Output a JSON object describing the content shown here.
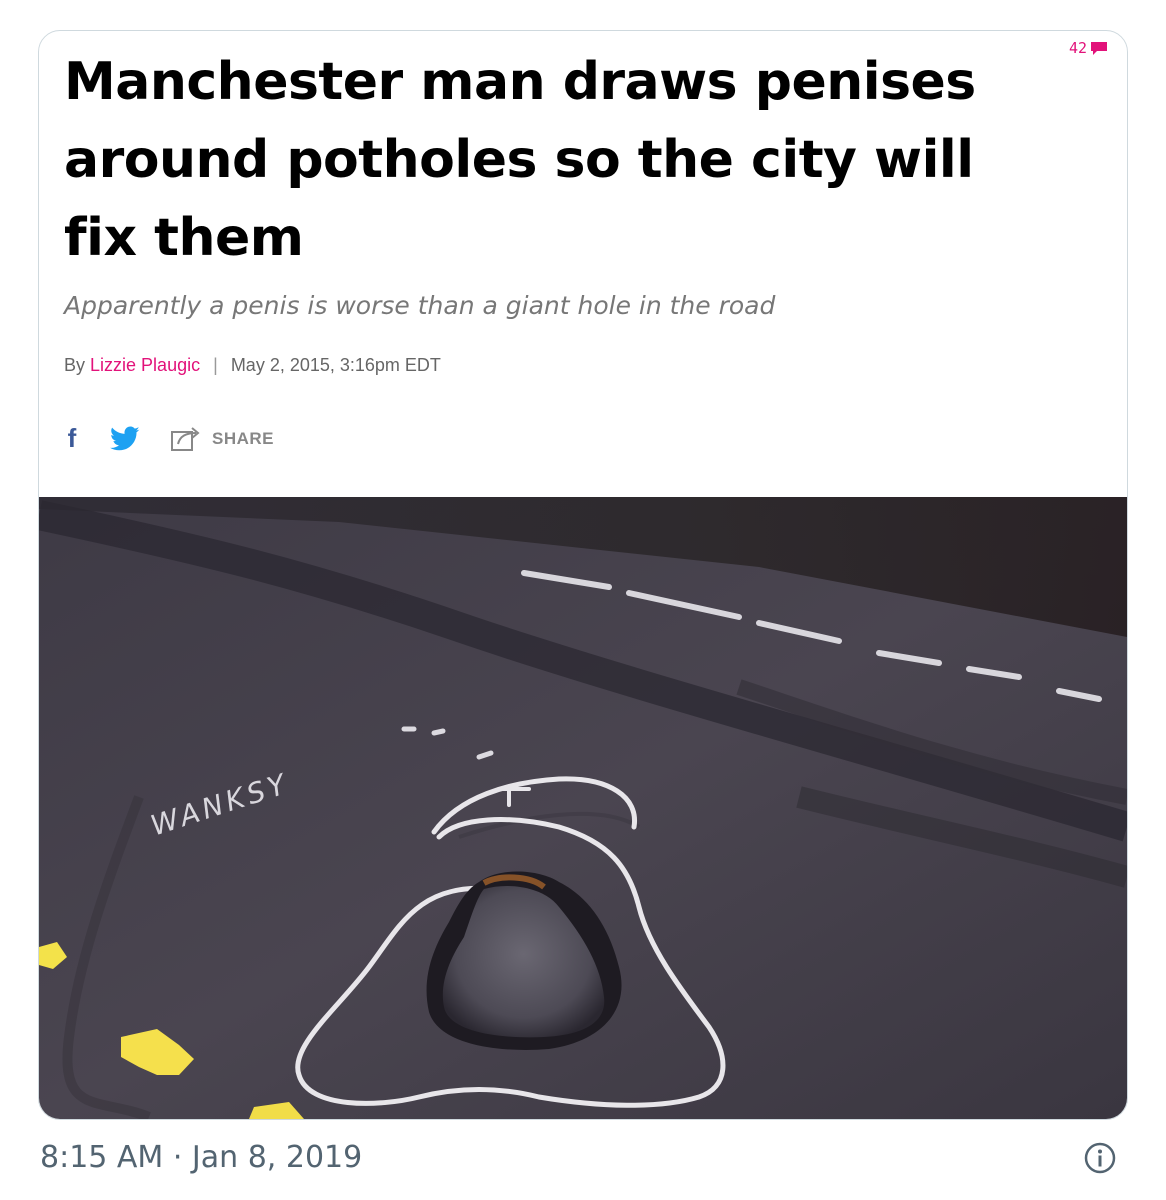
{
  "article": {
    "comment_count": "42",
    "headline": "Manchester man draws penises around potholes so the city will fix them",
    "dek": "Apparently a penis is worse than a giant hole in the road",
    "byline_prefix": "By",
    "author": "Lizzie Plaugic",
    "separator": "|",
    "date": "May 2, 2015, 3:16pm EDT",
    "facebook_glyph": "f",
    "share_label": "SHARE",
    "photo": {
      "chalk_text": "WANKSY"
    }
  },
  "tweet": {
    "timestamp": "8:15 AM · Jan 8, 2019"
  },
  "icons": [
    "facebook-icon",
    "twitter-icon",
    "share-icon",
    "comment-bubble-icon",
    "info-icon"
  ],
  "colors": {
    "accent": "#e2127a",
    "facebook": "#3b5998",
    "twitter": "#1da1f2",
    "muted_text": "#536471",
    "card_border": "#cfd9de"
  }
}
